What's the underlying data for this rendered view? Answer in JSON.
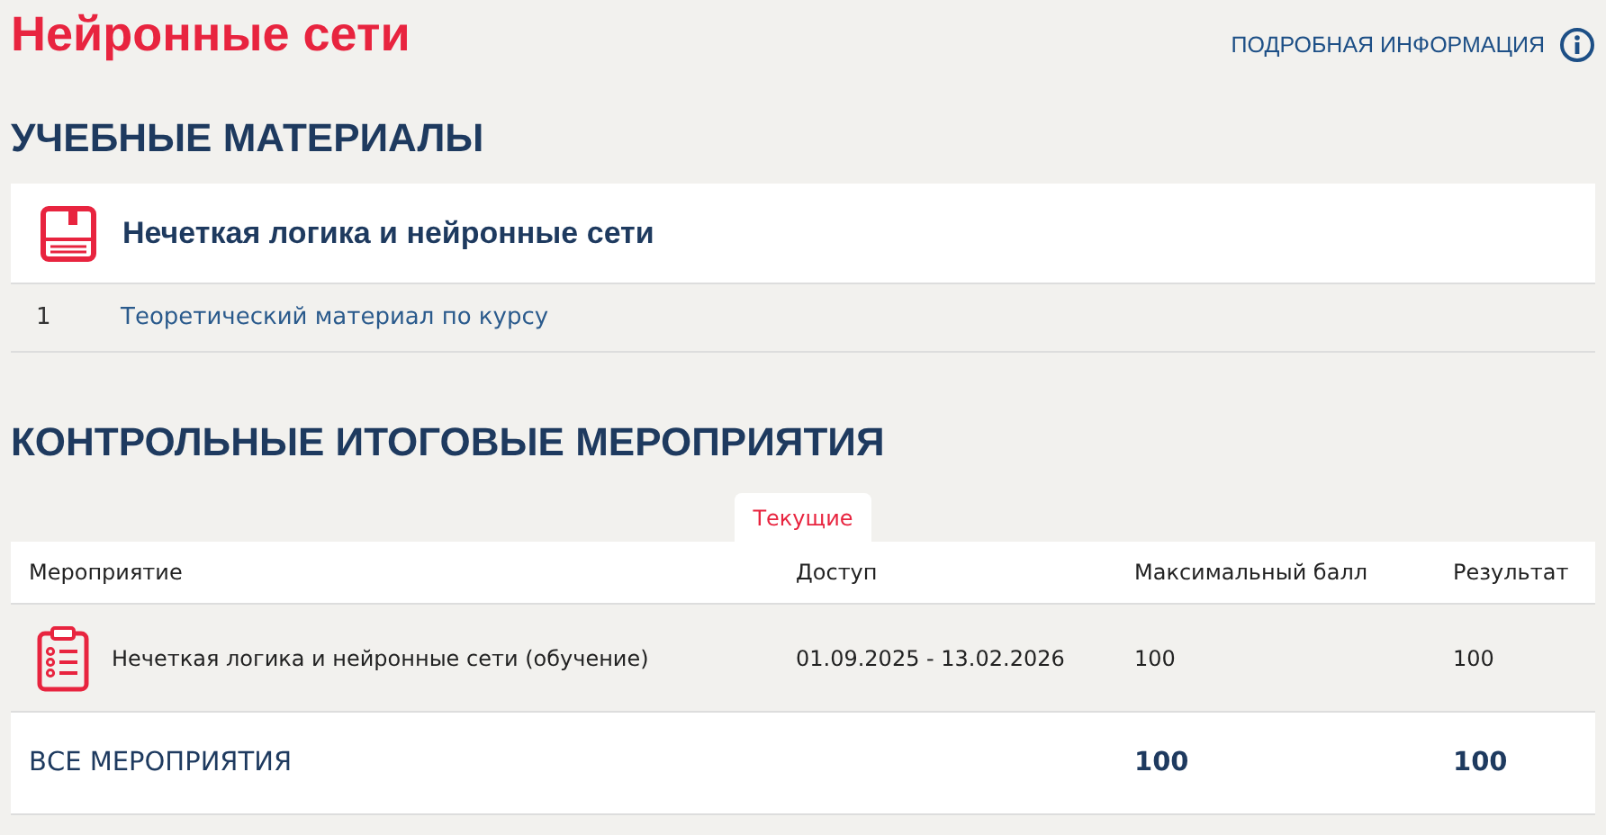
{
  "page_title": "Нейронные сети",
  "info_link": "ПОДРОБНАЯ ИНФОРМАЦИЯ",
  "materials": {
    "heading": "УЧЕБНЫЕ МАТЕРИАЛЫ",
    "course": "Нечеткая логика и нейронные сети",
    "items": [
      {
        "number": "1",
        "title": "Теоретический материал по курсу"
      }
    ]
  },
  "assessments": {
    "heading": "КОНТРОЛЬНЫЕ ИТОГОВЫЕ МЕРОПРИЯТИЯ",
    "tabs": [
      {
        "label": "Текущие",
        "selected": true
      }
    ],
    "columns": [
      "Мероприятие",
      "Доступ",
      "Максимальный балл",
      "Результат"
    ],
    "rows": [
      {
        "name": "Нечеткая логика и нейронные сети (обучение)",
        "access": "01.09.2025 - 13.02.2026",
        "max_score": "100",
        "result": "100"
      }
    ],
    "total": {
      "label": "ВСЕ МЕРОПРИЯТИЯ",
      "max_score": "100",
      "result": "100"
    }
  }
}
